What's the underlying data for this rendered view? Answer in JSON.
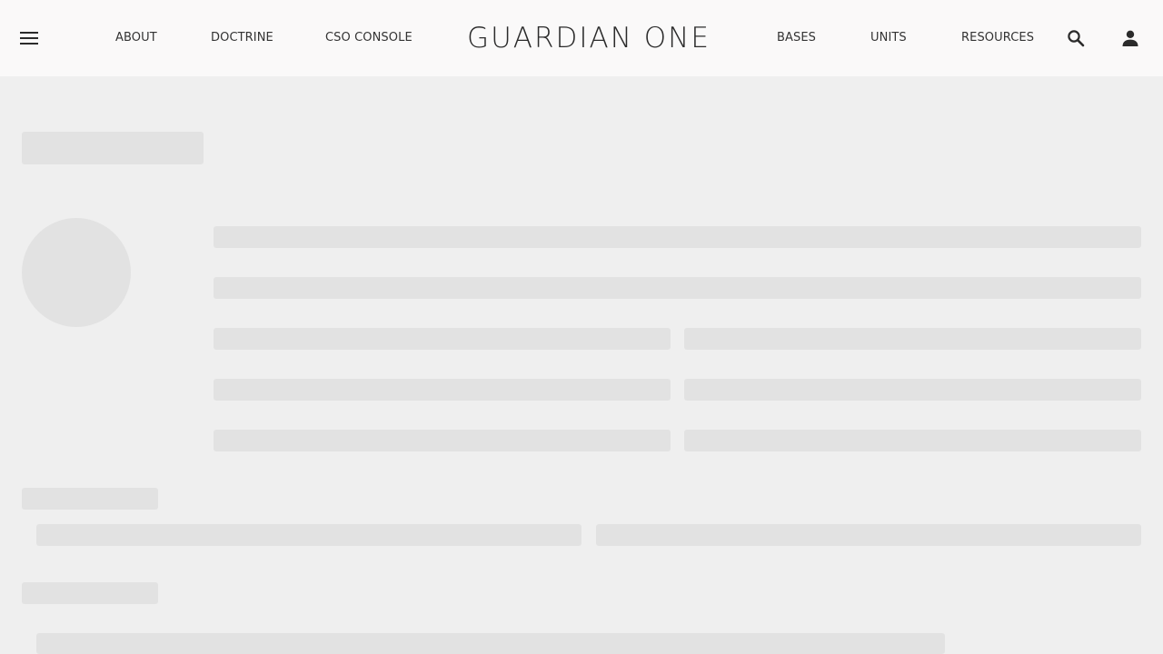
{
  "header": {
    "brand": "GUARDIAN ONE",
    "menu_icon": "hamburger-menu-icon",
    "nav_left": [
      {
        "label": "ABOUT"
      },
      {
        "label": "DOCTRINE"
      },
      {
        "label": "CSO CONSOLE"
      }
    ],
    "nav_right": [
      {
        "label": "BASES"
      },
      {
        "label": "UNITS"
      },
      {
        "label": "RESOURCES"
      }
    ],
    "search_icon": "search-icon",
    "account_icon": "person-icon"
  },
  "colors": {
    "header_bg": "#faf9f9",
    "page_bg": "#efefef",
    "skeleton": "#e2e2e2",
    "text": "#333333"
  }
}
